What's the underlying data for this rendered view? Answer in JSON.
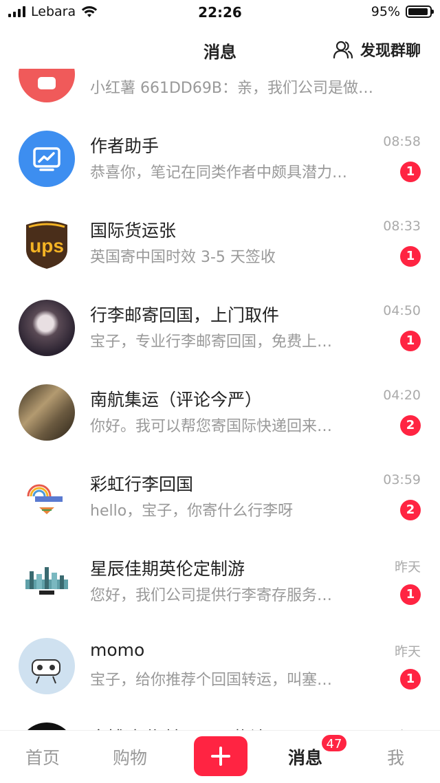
{
  "status_bar": {
    "carrier": "Lebara",
    "time": "22:26",
    "battery": "95%"
  },
  "header": {
    "title": "消息",
    "discover_label": "发现群聊"
  },
  "conversations": [
    {
      "name": "",
      "preview": "小红薯 661DD69B：亲，我们公司是做…",
      "time": "",
      "badge": "",
      "avatar_color": "#f05a5a"
    },
    {
      "name": "作者助手",
      "preview": "恭喜你，笔记在同类作者中颇具潜力…",
      "time": "08:58",
      "badge": "1",
      "avatar_color": "#3d8ef0"
    },
    {
      "name": "国际货运张",
      "preview": "英国寄中国时效 3-5 天签收",
      "time": "08:33",
      "badge": "1",
      "avatar_color": "#4a2e1a"
    },
    {
      "name": "行李邮寄回国，上门取件",
      "preview": "宝子，专业行李邮寄回国，免费上…",
      "time": "04:50",
      "badge": "1",
      "avatar_color": "#3a3040"
    },
    {
      "name": "南航集运（评论今严）",
      "preview": "你好。我可以帮您寄国际快递回来…",
      "time": "04:20",
      "badge": "2",
      "avatar_color": "#6b5a40"
    },
    {
      "name": "彩虹行李回国",
      "preview": "hello，宝子，你寄什么行李呀",
      "time": "03:59",
      "badge": "2",
      "avatar_color": "#ffffff"
    },
    {
      "name": "星辰佳期英伦定制游",
      "preview": "您好，我们公司提供行李寄存服务…",
      "time": "昨天",
      "badge": "1",
      "avatar_color": "#ffffff"
    },
    {
      "name": "momo",
      "preview": "宝子，给你推荐个回国转运，叫塞…",
      "time": "昨天",
      "badge": "1",
      "avatar_color": "#cfe1f0"
    },
    {
      "name": "塞博速递 转运回国物流",
      "preview": "",
      "time": "昨天",
      "badge": "",
      "avatar_color": "#111111"
    }
  ],
  "avatar_text": {
    "ups": "ups"
  },
  "tabbar": {
    "home": "首页",
    "shop": "购物",
    "messages": "消息",
    "messages_badge": "47",
    "me": "我"
  },
  "colors": {
    "accent": "#ff2442"
  }
}
